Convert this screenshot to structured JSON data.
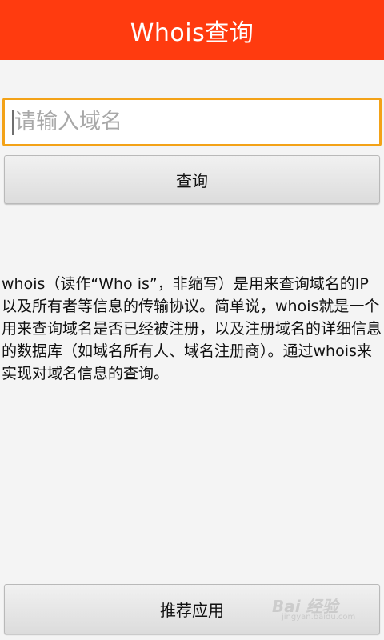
{
  "app": {
    "title": "Whois查询"
  },
  "search": {
    "placeholder": "请输入域名",
    "value": ""
  },
  "query_button": {
    "label": "查询"
  },
  "description": {
    "text": "whois（读作“Who is”，非缩写）是用来查询域名的IP以及所有者等信息的传输协议。简单说，whois就是一个用来查询域名是否已经被注册，以及注册域名的详细信息的数据库（如域名所有人、域名注册商）。通过whois来实现对域名信息的查询。"
  },
  "recommend_button": {
    "label": "推荐应用"
  },
  "watermark": {
    "main": "Bai 经验",
    "sub": "jingyan.baidu.com"
  },
  "colors": {
    "title_bar": "#ff3b0f",
    "input_focus_border": "#f3a217",
    "background": "#f4f4f4"
  }
}
